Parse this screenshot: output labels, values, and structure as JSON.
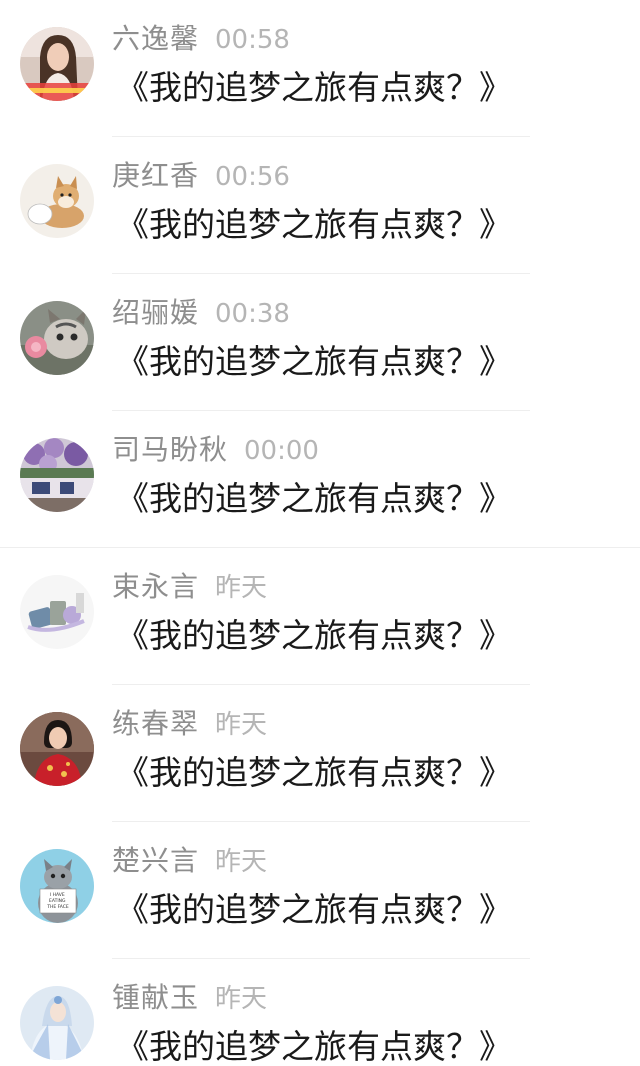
{
  "messages": [
    {
      "name": "六逸馨",
      "time": "00:58",
      "text": "《我的追梦之旅有点爽？》",
      "avatar": "girl-portrait-avatar"
    },
    {
      "name": "庚红香",
      "time": "00:56",
      "text": "《我的追梦之旅有点爽？》",
      "avatar": "shiba-dog-avatar"
    },
    {
      "name": "绍骊媛",
      "time": "00:38",
      "text": "《我的追梦之旅有点爽？》",
      "avatar": "cat-with-flower-avatar"
    },
    {
      "name": "司马盼秋",
      "time": "00:00",
      "text": "《我的追梦之旅有点爽？》",
      "avatar": "purple-flowers-avatar"
    },
    {
      "name": "束永言",
      "time": "昨天",
      "text": "《我的追梦之旅有点爽？》",
      "avatar": "stationery-items-avatar"
    },
    {
      "name": "练春翠",
      "time": "昨天",
      "text": "《我的追梦之旅有点爽？》",
      "avatar": "woman-red-qipao-avatar"
    },
    {
      "name": "楚兴言",
      "time": "昨天",
      "text": "《我的追梦之旅有点爽？》",
      "avatar": "cat-with-sign-avatar"
    },
    {
      "name": "锺献玉",
      "time": "昨天",
      "text": "《我的追梦之旅有点爽？》",
      "avatar": "fantasy-character-avatar"
    }
  ],
  "avatar_sign_text": "I HAVE EATING THE FACE",
  "colors": {
    "name": "#8e8e8e",
    "time": "#b5b5b5",
    "message": "#1a1a1a",
    "divider": "#eeeeee",
    "background": "#ffffff"
  }
}
